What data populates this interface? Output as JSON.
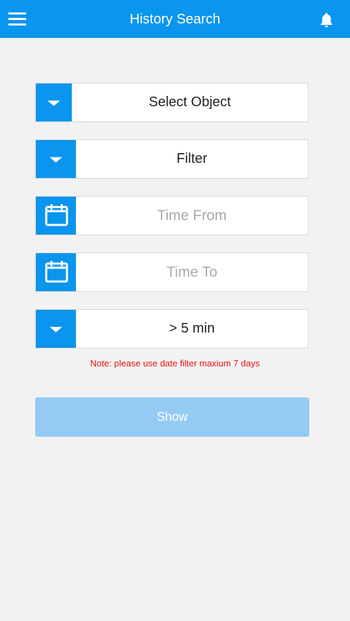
{
  "header": {
    "title": "History Search",
    "menu_icon": "hamburger-menu-icon",
    "bell_icon": "notification-bell-icon"
  },
  "form": {
    "select_object": {
      "label": "Select Object",
      "icon": "dropdown-caret-icon"
    },
    "filter": {
      "label": "Filter",
      "icon": "dropdown-caret-icon"
    },
    "time_from": {
      "placeholder": "Time From",
      "icon": "calendar-icon"
    },
    "time_to": {
      "placeholder": "Time To",
      "icon": "calendar-icon"
    },
    "duration": {
      "label": "> 5 min",
      "icon": "dropdown-caret-icon"
    },
    "note": "Note: please use date filter maxium 7 days",
    "show_label": "Show"
  },
  "colors": {
    "primary": "#0a95ee",
    "disabled_button": "#93cbf3",
    "note": "#ee1111",
    "background": "#f2f2f2"
  }
}
